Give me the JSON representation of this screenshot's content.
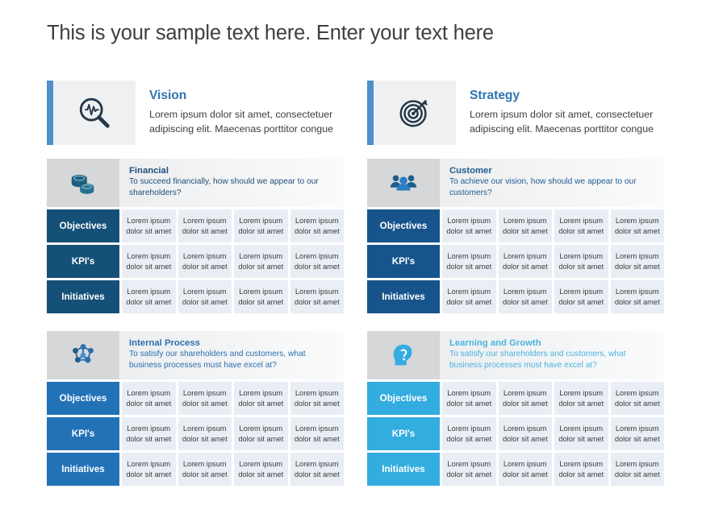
{
  "page": {
    "title": "This is your sample text here. Enter your text here"
  },
  "statements": [
    {
      "id": "vision",
      "title": "Vision",
      "description": "Lorem ipsum dolor sit amet, consectetuer adipiscing elit. Maecenas porttitor congue",
      "icon": "magnifier-pulse-icon",
      "accent_color": "#4e8fcc"
    },
    {
      "id": "strategy",
      "title": "Strategy",
      "description": "Lorem ipsum dolor sit amet, consectetuer adipiscing elit. Maecenas porttitor congue",
      "icon": "target-arrow-icon",
      "accent_color": "#4e8fcc"
    }
  ],
  "row_labels": [
    "Objectives",
    "KPI's",
    "Initiatives"
  ],
  "cell_text": "Lorem ipsum dolor sit amet",
  "quadrants": [
    {
      "id": "financial",
      "title": "Financial",
      "subtitle": "To succeed financially, how should we appear to our shareholders?",
      "icon": "coins-icon",
      "label_color": "#155078",
      "cell_color": "#e8eef4",
      "rows": [
        {
          "label": "Objectives",
          "cells": [
            "Lorem ipsum dolor sit amet",
            "Lorem ipsum dolor sit amet",
            "Lorem ipsum dolor sit amet",
            "Lorem ipsum dolor sit amet"
          ]
        },
        {
          "label": "KPI's",
          "cells": [
            "Lorem ipsum dolor sit amet",
            "Lorem ipsum dolor sit amet",
            "Lorem ipsum dolor sit amet",
            "Lorem ipsum dolor sit amet"
          ]
        },
        {
          "label": "Initiatives",
          "cells": [
            "Lorem ipsum dolor sit amet",
            "Lorem ipsum dolor sit amet",
            "Lorem ipsum dolor sit amet",
            "Lorem ipsum dolor sit amet"
          ]
        }
      ]
    },
    {
      "id": "customer",
      "title": "Customer",
      "subtitle": "To achieve our vision, how should we appear to our customers?",
      "icon": "people-group-icon",
      "label_color": "#17548c",
      "cell_color": "#e8eef4",
      "rows": [
        {
          "label": "Objectives",
          "cells": [
            "Lorem ipsum dolor sit amet",
            "Lorem ipsum dolor sit amet",
            "Lorem ipsum dolor sit amet",
            "Lorem ipsum dolor sit amet"
          ]
        },
        {
          "label": "KPI's",
          "cells": [
            "Lorem ipsum dolor sit amet",
            "Lorem ipsum dolor sit amet",
            "Lorem ipsum dolor sit amet",
            "Lorem ipsum dolor sit amet"
          ]
        },
        {
          "label": "Initiatives",
          "cells": [
            "Lorem ipsum dolor sit amet",
            "Lorem ipsum dolor sit amet",
            "Lorem ipsum dolor sit amet",
            "Lorem ipsum dolor sit amet"
          ]
        }
      ]
    },
    {
      "id": "internal-process",
      "title": "Internal Process",
      "subtitle": "To satisfy our shareholders and customers, what business processes must have excel at?",
      "icon": "network-nodes-icon",
      "label_color": "#2272b8",
      "cell_color": "#e8eef4",
      "rows": [
        {
          "label": "Objectives",
          "cells": [
            "Lorem ipsum dolor sit amet",
            "Lorem ipsum dolor sit amet",
            "Lorem ipsum dolor sit amet",
            "Lorem ipsum dolor sit amet"
          ]
        },
        {
          "label": "KPI's",
          "cells": [
            "Lorem ipsum dolor sit amet",
            "Lorem ipsum dolor sit amet",
            "Lorem ipsum dolor sit amet",
            "Lorem ipsum dolor sit amet"
          ]
        },
        {
          "label": "Initiatives",
          "cells": [
            "Lorem ipsum dolor sit amet",
            "Lorem ipsum dolor sit amet",
            "Lorem ipsum dolor sit amet",
            "Lorem ipsum dolor sit amet"
          ]
        }
      ]
    },
    {
      "id": "learning-growth",
      "title": "Learning and Growth",
      "subtitle": "To satisfy our shareholders and customers, what business processes must have excel at?",
      "icon": "head-question-icon",
      "label_color": "#33ace0",
      "cell_color": "#e8eef4",
      "rows": [
        {
          "label": "Objectives",
          "cells": [
            "Lorem ipsum dolor sit amet",
            "Lorem ipsum dolor sit amet",
            "Lorem ipsum dolor sit amet",
            "Lorem ipsum dolor sit amet"
          ]
        },
        {
          "label": "KPI's",
          "cells": [
            "Lorem ipsum dolor sit amet",
            "Lorem ipsum dolor sit amet",
            "Lorem ipsum dolor sit amet",
            "Lorem ipsum dolor sit amet"
          ]
        },
        {
          "label": "Initiatives",
          "cells": [
            "Lorem ipsum dolor sit amet",
            "Lorem ipsum dolor sit amet",
            "Lorem ipsum dolor sit amet",
            "Lorem ipsum dolor sit amet"
          ]
        }
      ]
    }
  ]
}
